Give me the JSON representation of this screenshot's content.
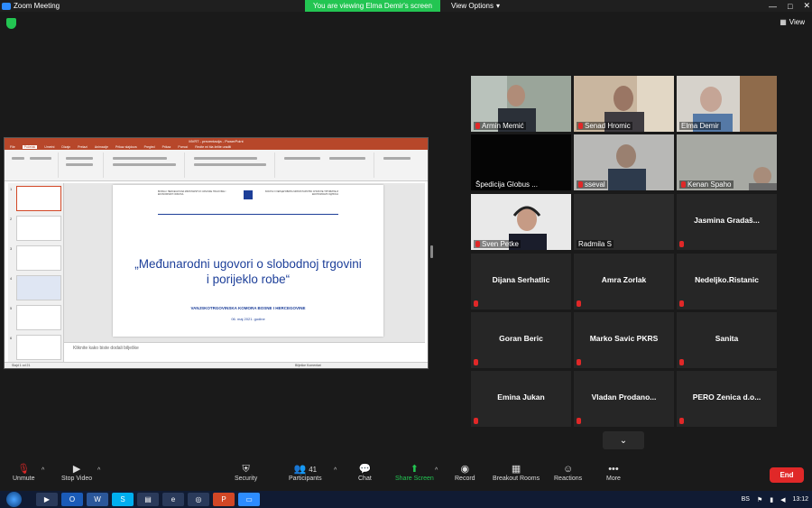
{
  "window": {
    "title": "Zoom Meeting",
    "banner": "You are viewing Elma Demir's screen",
    "view_options": "View Options",
    "view_button": "View",
    "minimize": "—",
    "maximize": "□",
    "close": "✕"
  },
  "shared_screen": {
    "app_title": "MVRT - prezentacija - PowerPoint",
    "ribbon_tabs": [
      "File",
      "Početak",
      "Umetni",
      "Dizajn",
      "Prelazi",
      "Animacije",
      "Prikaz slajdova",
      "Pregled",
      "Prikaz",
      "Pomoć",
      "Recite mi šta želite uraditi"
    ],
    "slide_header_left": "BOSNA I HERCEGOVINA MINISTARSTVO VANJSKE TRGOVINE I EKONOMSKIH ODNOSA",
    "slide_header_right": "БОСНА И ХЕРЦЕГОВИНА МИНИСТАРСТВО СПОЉНЕ ТРГОВИНЕ И ЕКОНОМСКИХ ОДНОСА",
    "slide_title_line1": "„Međunarodni ugovori o slobodnoj trgovini",
    "slide_title_line2": "i porijeklo robe“",
    "slide_org": "VANJSKOTRGOVINSKA KOMORA BOSNE I HERCEGOVINE",
    "slide_date": "06. maj 2021. godine",
    "notes_placeholder": "Kliknite kako biste dodali bilješke",
    "thumb_numbers": [
      "1",
      "2",
      "3",
      "4",
      "5",
      "6"
    ],
    "status_left": "Slajd 1 od 21",
    "status_right": "Bilješke   Komentari"
  },
  "participants": [
    {
      "name": "Armin Memić",
      "video": true,
      "highlight": false
    },
    {
      "name": "Senad Hromic",
      "video": true,
      "highlight": false
    },
    {
      "name": "Elma Demir",
      "video": true,
      "highlight": true
    },
    {
      "name": "Špedicija Globus ...",
      "video": true,
      "highlight": false
    },
    {
      "name": "sseval",
      "video": true,
      "highlight": false
    },
    {
      "name": "Kenan Spaho",
      "video": true,
      "highlight": false
    },
    {
      "name": "Sven Petke",
      "video": true,
      "highlight": false
    },
    {
      "name": "Radmila S",
      "video": true,
      "highlight": false
    },
    {
      "name": "Jasmina  Gradaš...",
      "video": false,
      "highlight": false
    },
    {
      "name": "Dijana Serhatlic",
      "video": false,
      "highlight": false
    },
    {
      "name": "Amra Zorlak",
      "video": false,
      "highlight": false
    },
    {
      "name": "Nedeljko.Ristanic",
      "video": false,
      "highlight": false
    },
    {
      "name": "Goran Beric",
      "video": false,
      "highlight": false
    },
    {
      "name": "Marko Savic PKRS",
      "video": false,
      "highlight": false
    },
    {
      "name": "Sanita",
      "video": false,
      "highlight": false
    },
    {
      "name": "Emina Jukan",
      "video": false,
      "highlight": false
    },
    {
      "name": "Vladan  Prodano...",
      "video": false,
      "highlight": false
    },
    {
      "name": "PERO  Zenica  d.o...",
      "video": false,
      "highlight": false
    }
  ],
  "toolbar": {
    "unmute": "Unmute",
    "stop_video": "Stop Video",
    "security": "Security",
    "participants": "Participants",
    "participants_count": "41",
    "chat": "Chat",
    "share_screen": "Share Screen",
    "record": "Record",
    "breakout_rooms": "Breakout Rooms",
    "reactions": "Reactions",
    "more": "More",
    "end": "End"
  },
  "taskbar": {
    "lang": "BS",
    "time": "13:12"
  },
  "colors": {
    "accent_green": "#23c552",
    "end_red": "#e02828",
    "highlight": "#c8d13a",
    "ppt_red": "#b7472a"
  }
}
